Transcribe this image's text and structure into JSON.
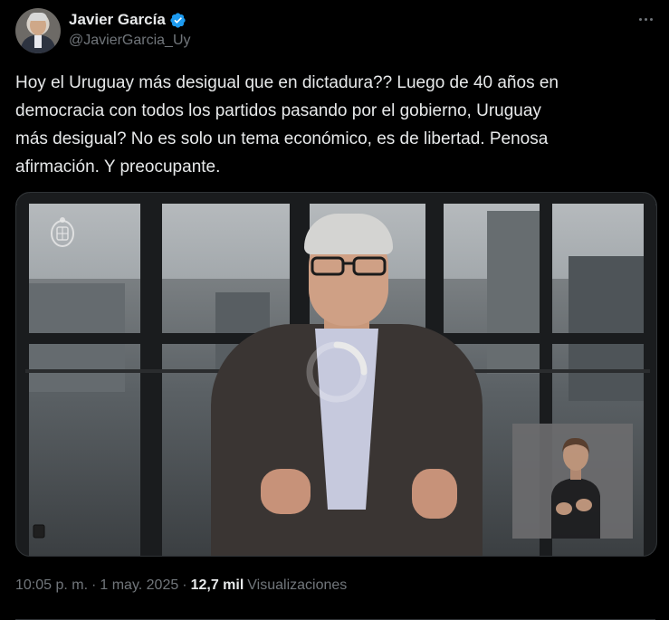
{
  "author": {
    "display_name": "Javier García",
    "handle": "@JavierGarcia_Uy",
    "verified_icon": "verified-badge-icon",
    "verified_color": "#1d9bf0"
  },
  "tweet": {
    "text": "Hoy el Uruguay más desigual que en dictadura?? Luego de 40 años en\ndemocracia con todos los partidos pasando por el gobierno, Uruguay\nmás desigual? No es solo un tema económico, es de libertad. Penosa\nafirmación. Y preocupante."
  },
  "media": {
    "type": "video",
    "state_icon": "loading-spinner-icon",
    "overlay_icon": "coat-of-arms-icon",
    "inset": "sign-language-interpreter"
  },
  "meta": {
    "time": "10:05 p. m.",
    "separator": "·",
    "date": "1 may. 2025",
    "views_count": "12,7 mil",
    "views_label": "Visualizaciones"
  },
  "colors": {
    "background": "#000000",
    "text_primary": "#e7e9ea",
    "text_secondary": "#71767b",
    "border": "#2f3336"
  }
}
